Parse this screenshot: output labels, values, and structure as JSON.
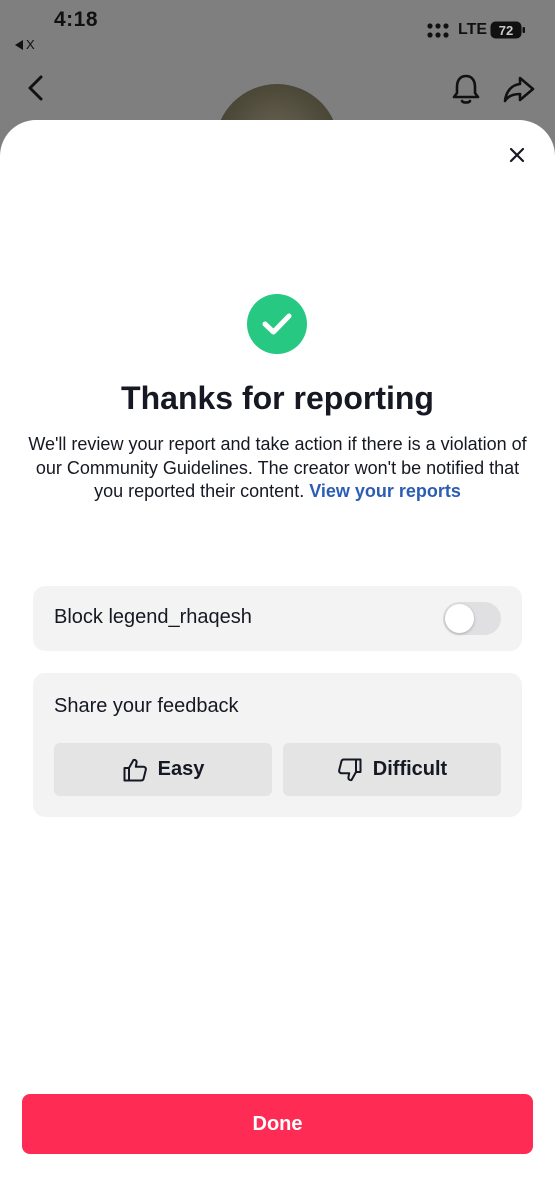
{
  "status_bar": {
    "time": "4:18",
    "back_app": "X",
    "network": "LTE",
    "battery": "72"
  },
  "background": {
    "icons": [
      "chevron-left-icon",
      "bell-icon",
      "share-icon"
    ]
  },
  "sheet": {
    "title": "Thanks for reporting",
    "message": "We'll review your report and take action if there is a violation of our Community Guidelines. The creator won't be notified that you reported their content.",
    "view_reports_link": "View your reports",
    "block": {
      "label": "Block legend_rhaqesh",
      "enabled": false
    },
    "feedback": {
      "label": "Share your feedback",
      "easy_label": "Easy",
      "difficult_label": "Difficult"
    },
    "done_label": "Done"
  },
  "colors": {
    "accent": "#fe2c55",
    "success": "#27c882",
    "link": "#2b5db4",
    "card": "#f3f3f3"
  }
}
